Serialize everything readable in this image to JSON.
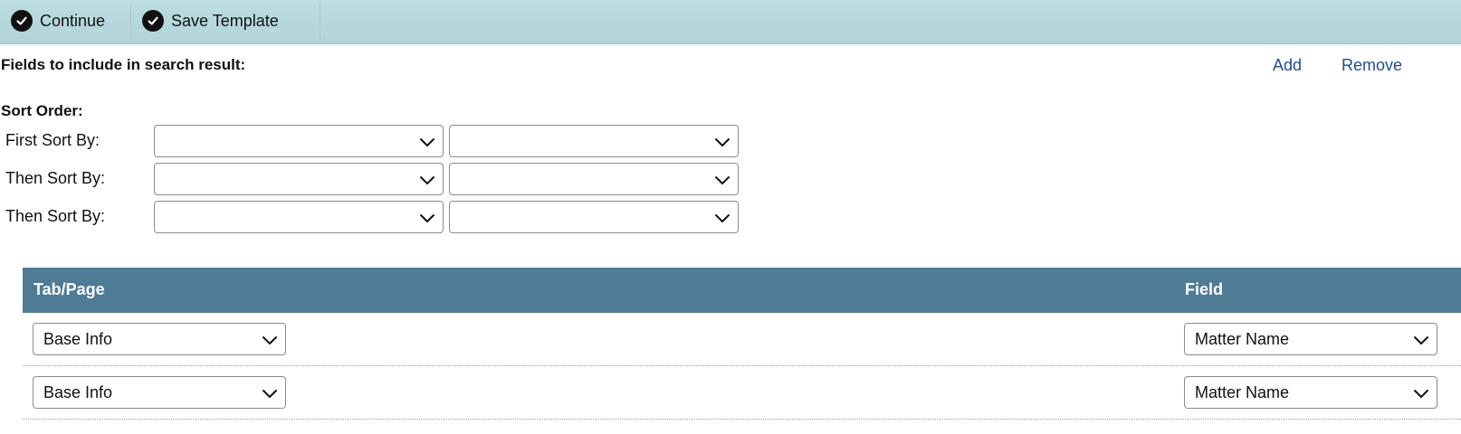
{
  "toolbar": {
    "continue_label": "Continue",
    "save_template_label": "Save Template",
    "icon": "check-circle-icon"
  },
  "fields_section": {
    "label": "Fields to include in search result:",
    "add_label": "Add",
    "remove_label": "Remove",
    "link_color": "#1f4e8f"
  },
  "sort_order": {
    "title": "Sort Order:",
    "rows": [
      {
        "label": "First Sort By:",
        "field_value": "",
        "direction_value": ""
      },
      {
        "label": "Then Sort By:",
        "field_value": "",
        "direction_value": ""
      },
      {
        "label": "Then Sort By:",
        "field_value": "",
        "direction_value": ""
      }
    ]
  },
  "table": {
    "header_color": "#4f7b95",
    "columns": [
      "Tab/Page",
      "Field"
    ],
    "rows": [
      {
        "tab_page": "Base Info",
        "field": "Matter Name"
      },
      {
        "tab_page": "Base Info",
        "field": "Matter Name"
      }
    ]
  }
}
